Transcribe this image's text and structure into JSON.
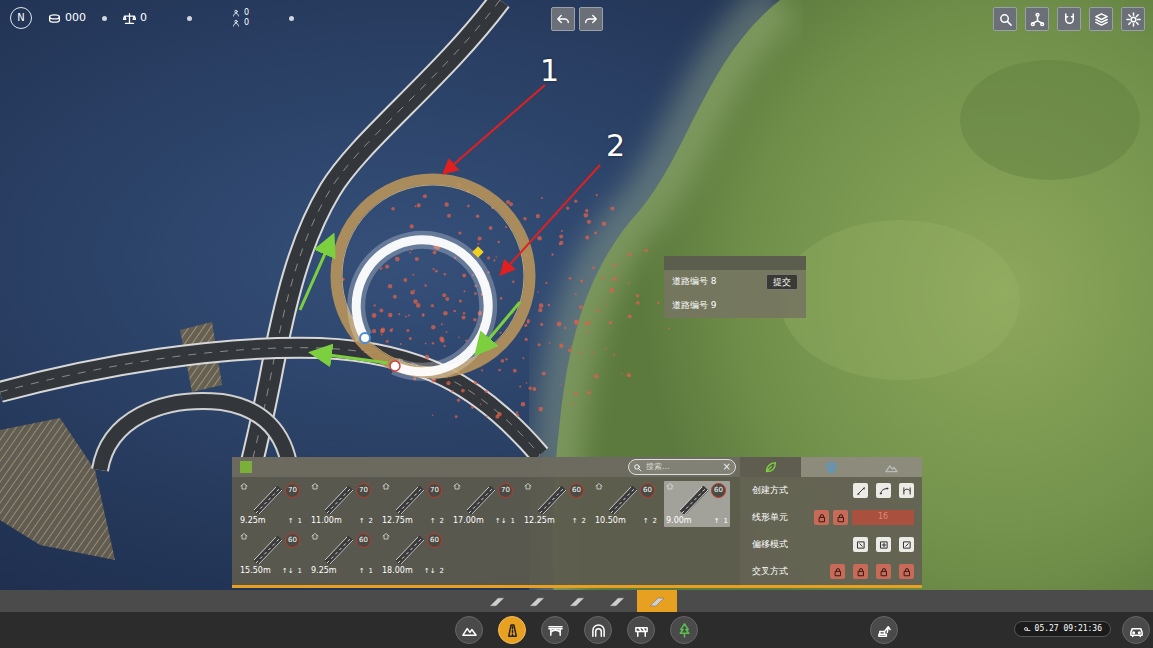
{
  "hud": {
    "compass": "N",
    "coins": "000",
    "balance": "0",
    "stats": [
      "0",
      "0"
    ]
  },
  "annotations": [
    "1",
    "2"
  ],
  "popup": {
    "rows": [
      "道路编号 8",
      "道路编号 9"
    ],
    "submit": "提交"
  },
  "palette": {
    "search": {
      "placeholder": "搜索..."
    },
    "clear": "×",
    "roads": [
      {
        "width": "9.25m",
        "speed": "70",
        "dir": "↑",
        "lanes": "1",
        "selected": false
      },
      {
        "width": "11.00m",
        "speed": "70",
        "dir": "↑",
        "lanes": "2",
        "selected": false
      },
      {
        "width": "12.75m",
        "speed": "70",
        "dir": "↑",
        "lanes": "2",
        "selected": false
      },
      {
        "width": "17.00m",
        "speed": "70",
        "dir": "↑↓",
        "lanes": "1",
        "selected": false
      },
      {
        "width": "12.25m",
        "speed": "60",
        "dir": "↑",
        "lanes": "2",
        "selected": false
      },
      {
        "width": "10.50m",
        "speed": "60",
        "dir": "↑",
        "lanes": "2",
        "selected": false
      },
      {
        "width": "9.00m",
        "speed": "60",
        "dir": "↑",
        "lanes": "1",
        "selected": true
      },
      {
        "width": "15.50m",
        "speed": "60",
        "dir": "↑↓",
        "lanes": "1",
        "selected": false
      },
      {
        "width": "9.25m",
        "speed": "60",
        "dir": "↑",
        "lanes": "1",
        "selected": false
      },
      {
        "width": "18.00m",
        "speed": "60",
        "dir": "↑↓",
        "lanes": "2",
        "selected": false
      }
    ]
  },
  "settings": {
    "tabs": [
      {
        "selected": true
      },
      {
        "selected": false
      },
      {
        "selected": false
      }
    ],
    "rows": [
      {
        "label": "创建方式",
        "kind": "buttons",
        "options": [
          {
            "selected": false
          },
          {
            "selected": false
          },
          {
            "selected": false
          }
        ]
      },
      {
        "label": "线形单元",
        "kind": "field",
        "value": "16",
        "options": [
          {
            "selected": false
          },
          {
            "selected": false
          }
        ]
      },
      {
        "label": "偏移模式",
        "kind": "buttons",
        "options": [
          {
            "selected": false
          },
          {
            "selected": false
          },
          {
            "selected": false
          }
        ]
      },
      {
        "label": "交叉方式",
        "kind": "toggles",
        "options": [
          {
            "selected": false
          },
          {
            "selected": false
          },
          {
            "selected": false
          },
          {
            "selected": false
          }
        ]
      }
    ]
  },
  "toolbar": {
    "categories": [
      {
        "selected": false
      },
      {
        "selected": false
      },
      {
        "selected": false
      },
      {
        "selected": false
      },
      {
        "selected": true
      }
    ],
    "tools": [
      {
        "selected": false
      },
      {
        "selected": true
      },
      {
        "selected": false
      },
      {
        "selected": false
      },
      {
        "selected": false
      },
      {
        "selected": false
      }
    ],
    "clock": "05.27 09:21:36"
  }
}
